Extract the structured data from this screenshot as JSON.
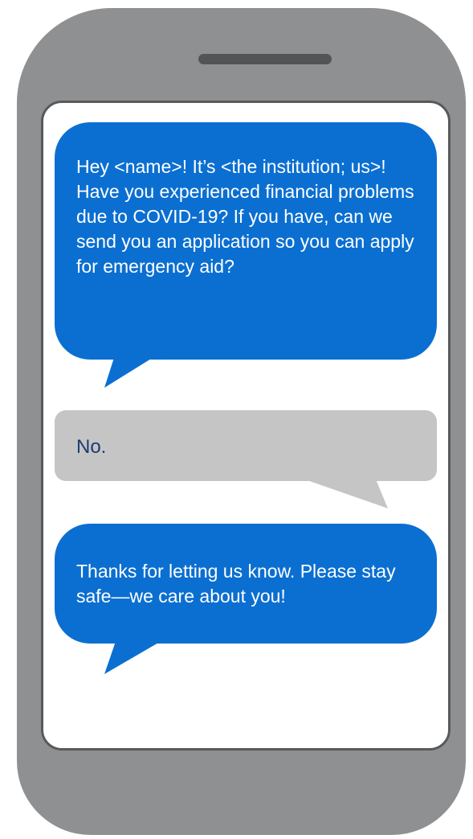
{
  "messages": [
    {
      "sender": "institution",
      "text": "Hey <name>! It’s <the institution; us>! Have you experienced financial problems due to COVID-19? If you have, can we send you an application so you can apply for emergency aid?"
    },
    {
      "sender": "user",
      "text": "No."
    },
    {
      "sender": "institution",
      "text": "Thanks for letting us know. Please stay safe—we care about you!"
    }
  ],
  "colors": {
    "phone_body": "#8f9092",
    "speaker": "#525456",
    "screen_border": "#57595b",
    "screen": "#ffffff",
    "incoming_bubble": "#0b6fd1",
    "incoming_text": "#ffffff",
    "outgoing_bubble": "#c5c5c5",
    "outgoing_text": "#1f3b70"
  }
}
